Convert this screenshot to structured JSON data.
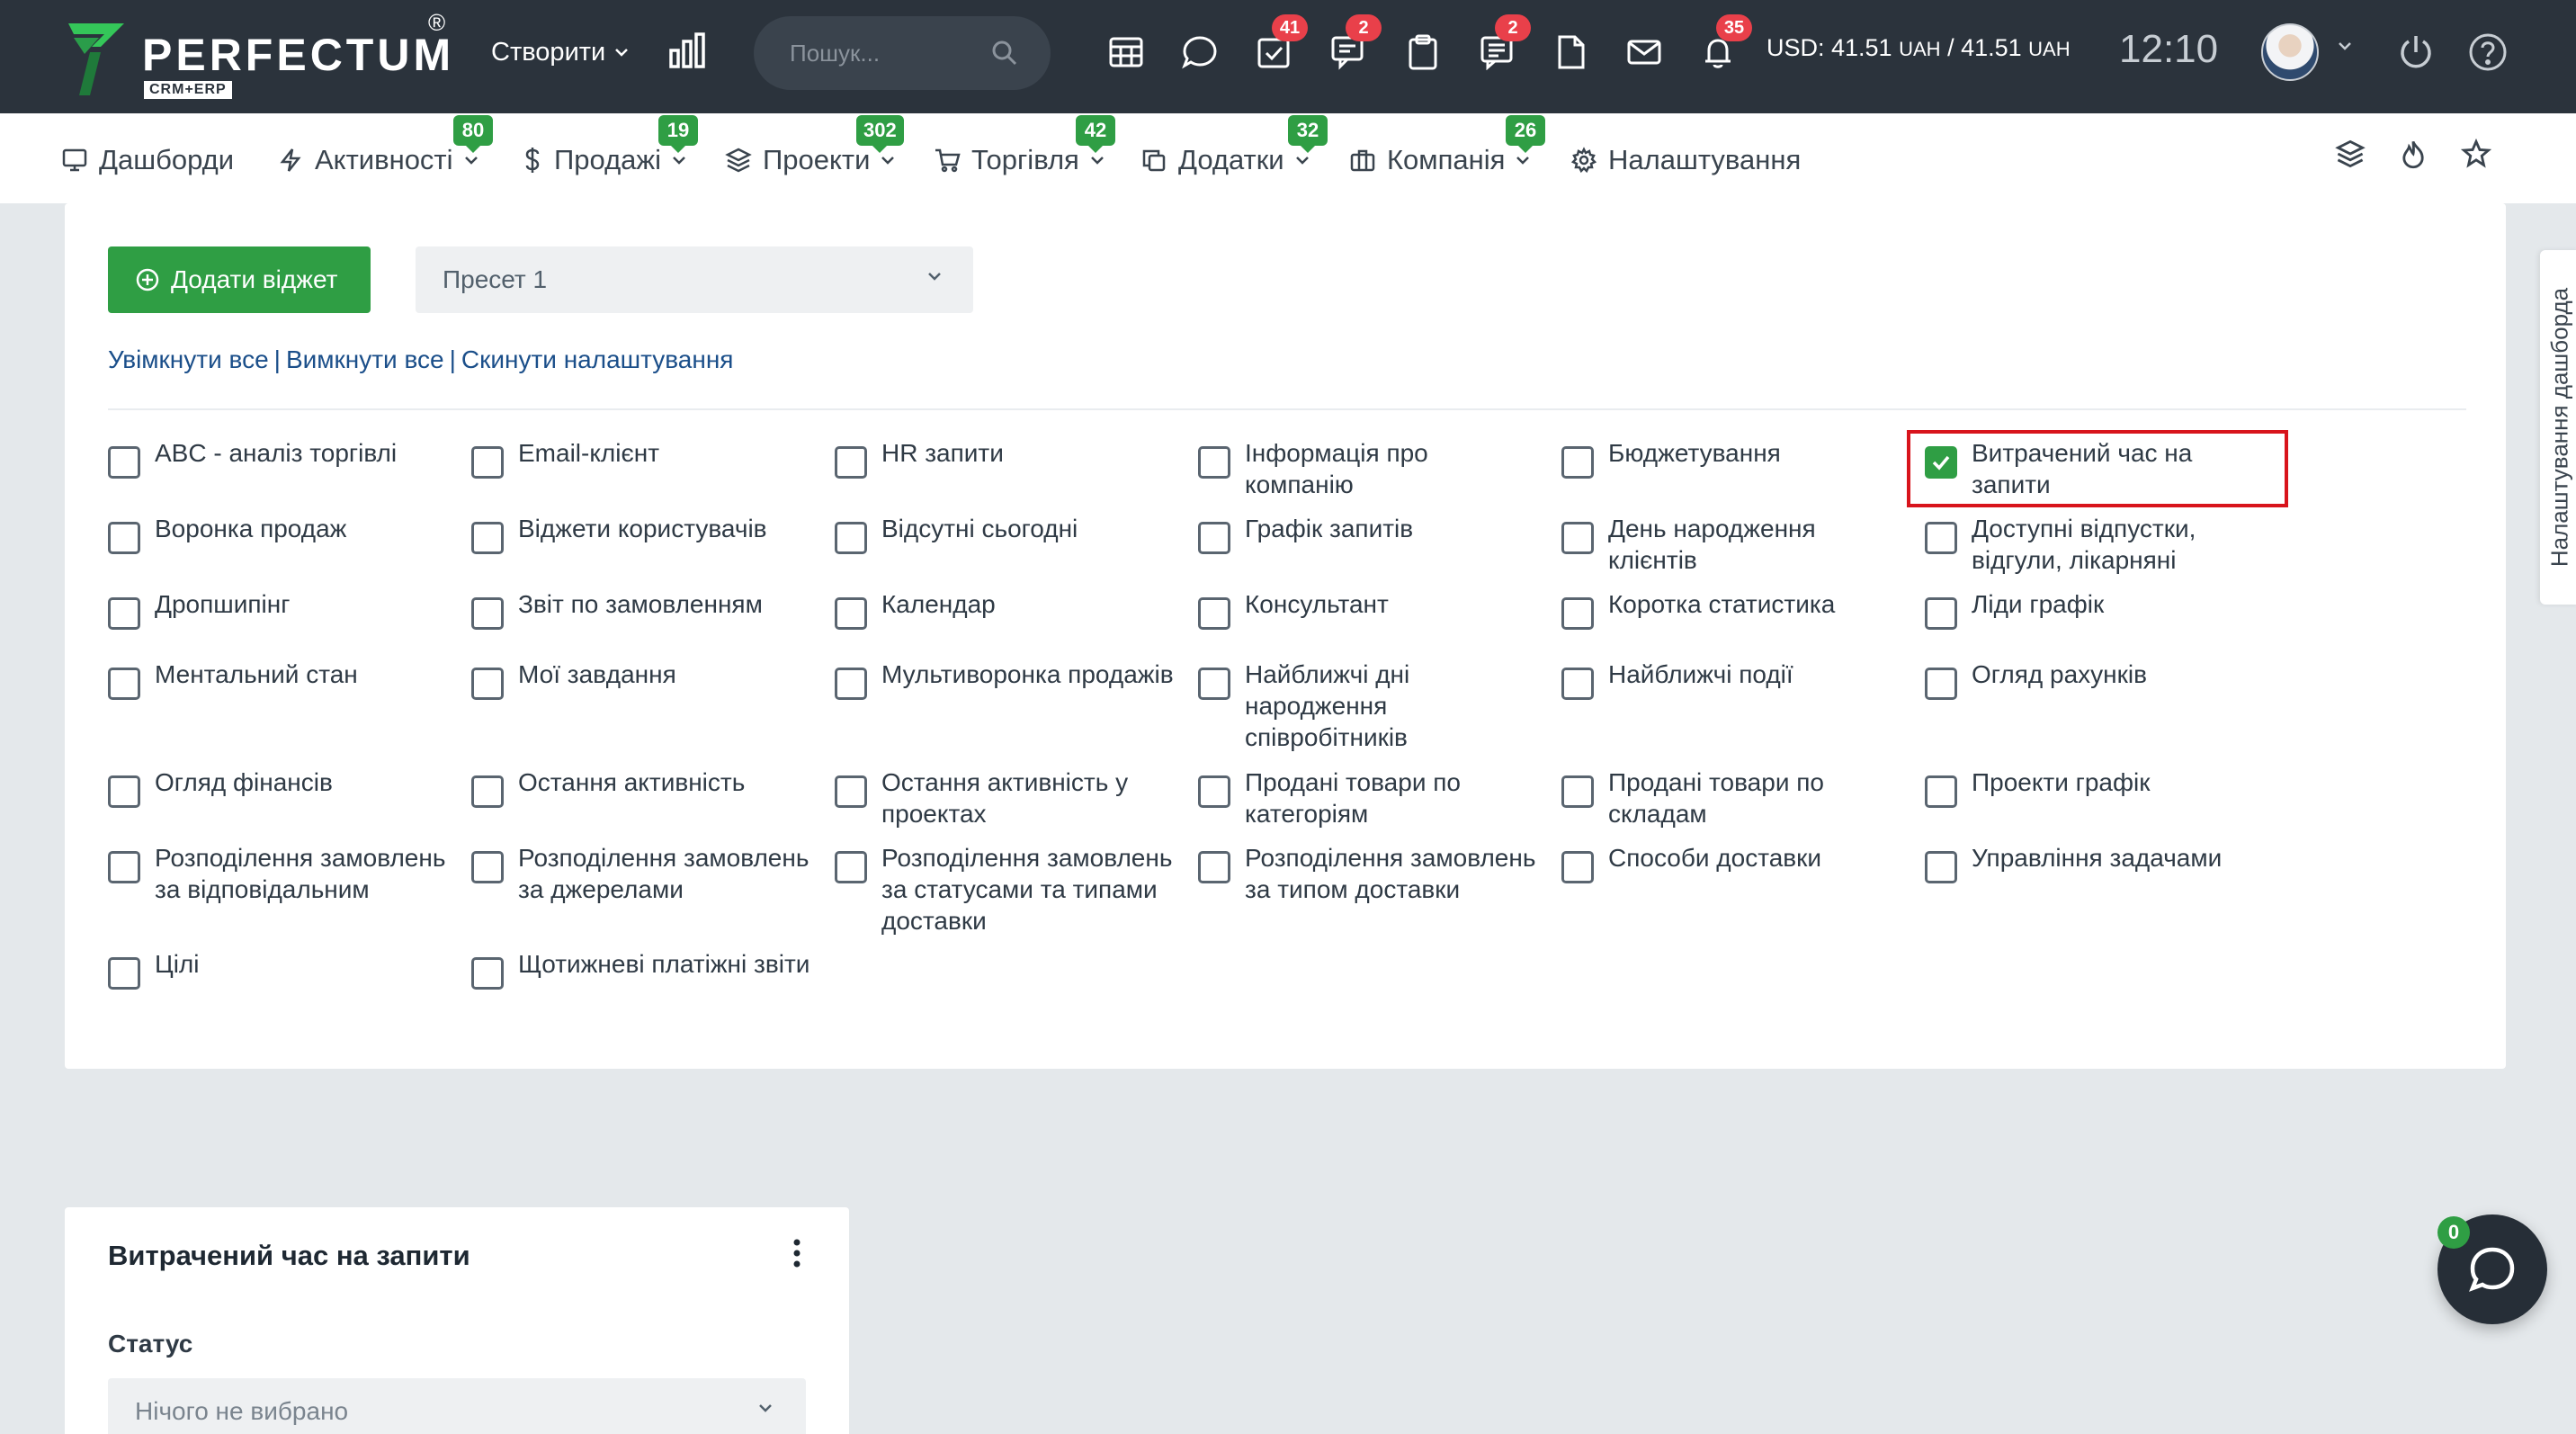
{
  "header": {
    "brand": "PERFECTUM",
    "brand_sub": "CRM+ERP",
    "brand_reg": "®",
    "create_label": "Створити",
    "search_placeholder": "Пошук...",
    "badges": {
      "tasks": "41",
      "chat": "2",
      "requests": "2",
      "notifications": "35"
    },
    "currency_usd": "USD: 41.51",
    "currency_unit1": "UAH",
    "currency_sep": "/ 41.51",
    "currency_unit2": "UAH",
    "time": "12:10"
  },
  "nav": {
    "items": [
      {
        "label": "Дашборди",
        "icon": "monitor-icon",
        "badge": ""
      },
      {
        "label": "Активності",
        "icon": "bolt-icon",
        "badge": "80"
      },
      {
        "label": "Продажі",
        "icon": "dollar-icon",
        "badge": "19"
      },
      {
        "label": "Проекти",
        "icon": "layers-icon",
        "badge": "302"
      },
      {
        "label": "Торгівля",
        "icon": "cart-icon",
        "badge": "42"
      },
      {
        "label": "Додатки",
        "icon": "copy-icon",
        "badge": "32"
      },
      {
        "label": "Компанія",
        "icon": "briefcase-icon",
        "badge": "26"
      },
      {
        "label": "Налаштування",
        "icon": "gear-icon",
        "badge": ""
      }
    ]
  },
  "panel": {
    "add_widget_label": "Додати віджет",
    "preset_value": "Пресет 1",
    "links": [
      "Увімкнути все",
      "Вимкнути все",
      "Скинути налаштування"
    ],
    "link_separator": "|",
    "widgets": [
      {
        "label": "ABC - аналіз торгівлі",
        "checked": false
      },
      {
        "label": "Email-клієнт",
        "checked": false
      },
      {
        "label": "HR запити",
        "checked": false
      },
      {
        "label": "Інформація про компанію",
        "checked": false
      },
      {
        "label": "Бюджетування",
        "checked": false
      },
      {
        "label": "Витрачений час на запити",
        "checked": true
      },
      {
        "label": "Воронка продаж",
        "checked": false
      },
      {
        "label": "Віджети користувачів",
        "checked": false
      },
      {
        "label": "Відсутні сьогодні",
        "checked": false
      },
      {
        "label": "Графік запитів",
        "checked": false
      },
      {
        "label": "День народження клієнтів",
        "checked": false
      },
      {
        "label": "Доступні відпустки, відгули, лікарняні",
        "checked": false
      },
      {
        "label": "Дропшипінг",
        "checked": false
      },
      {
        "label": "Звіт по замовленням",
        "checked": false
      },
      {
        "label": "Календар",
        "checked": false
      },
      {
        "label": "Консультант",
        "checked": false
      },
      {
        "label": "Коротка статистика",
        "checked": false
      },
      {
        "label": "Ліди графік",
        "checked": false
      },
      {
        "label": "Ментальний стан",
        "checked": false
      },
      {
        "label": "Мої завдання",
        "checked": false
      },
      {
        "label": "Мультиворонка продажів",
        "checked": false
      },
      {
        "label": "Найближчі дні народження співробітників",
        "checked": false
      },
      {
        "label": "Найближчі події",
        "checked": false
      },
      {
        "label": "Огляд рахунків",
        "checked": false
      },
      {
        "label": "Огляд фінансів",
        "checked": false
      },
      {
        "label": "Остання активність",
        "checked": false
      },
      {
        "label": "Остання активність у проектах",
        "checked": false
      },
      {
        "label": "Продані товари по категоріям",
        "checked": false
      },
      {
        "label": "Продані товари по складам",
        "checked": false
      },
      {
        "label": "Проекти графік",
        "checked": false
      },
      {
        "label": "Розподілення замовлень за відповідальним",
        "checked": false
      },
      {
        "label": "Розподілення замовлень за джерелами",
        "checked": false
      },
      {
        "label": "Розподілення замовлень за статусами та типами доставки",
        "checked": false
      },
      {
        "label": "Розподілення замовлень за типом доставки",
        "checked": false
      },
      {
        "label": "Способи доставки",
        "checked": false
      },
      {
        "label": "Управління задачами",
        "checked": false
      },
      {
        "label": "Цілі",
        "checked": false
      },
      {
        "label": "Щотижневі платіжні звіти",
        "checked": false
      }
    ]
  },
  "widget_card": {
    "title": "Витрачений час на запити",
    "status_label": "Статус",
    "status_placeholder": "Нічого не вибрано"
  },
  "side_tab_label": "Налаштування дашборда",
  "chat_badge": "0",
  "colors": {
    "topbar": "#2b333c",
    "accent_green": "#2f9e44",
    "badge_red": "#e9404a",
    "link_blue": "#1b4f8a",
    "highlight_red": "#d8141c"
  }
}
